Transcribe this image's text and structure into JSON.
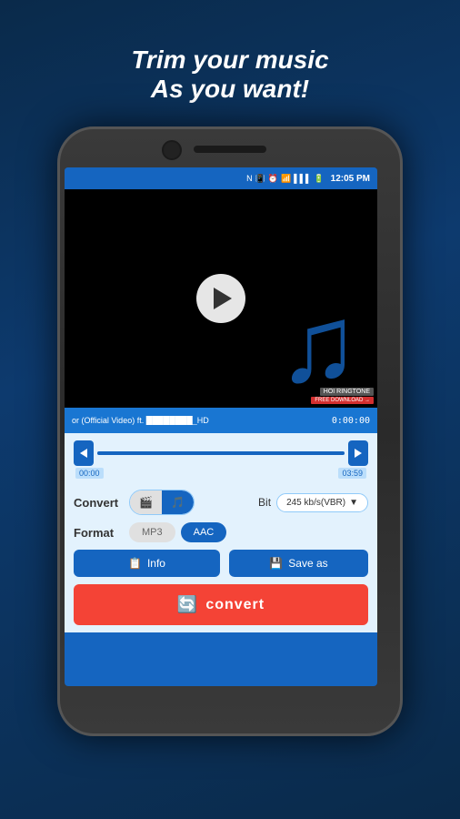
{
  "tagline": {
    "line1": "Trim your music",
    "line2": "As you want!"
  },
  "status_bar": {
    "time": "12:05 PM",
    "icons": [
      "NFC",
      "vibrate",
      "alarm",
      "wifi",
      "signal",
      "battery"
    ]
  },
  "player": {
    "track_name": "or (Official Video) ft. ████████_HD",
    "track_time": "0:00:00",
    "start_time": "00:00",
    "end_time": "03:59",
    "badge_top": "HOI RINGTONE",
    "badge_bottom": "FREE DOWNLOAD →"
  },
  "controls": {
    "convert_label": "Convert",
    "type_video_icon": "🎬",
    "type_audio_icon": "🎵",
    "bit_label": "Bit",
    "bit_value": "245 kb/s(VBR)",
    "format_label": "Format",
    "format_mp3": "MP3",
    "format_aac": "AAC",
    "info_btn": "Info",
    "save_btn": "Save as",
    "convert_btn": "convert"
  }
}
